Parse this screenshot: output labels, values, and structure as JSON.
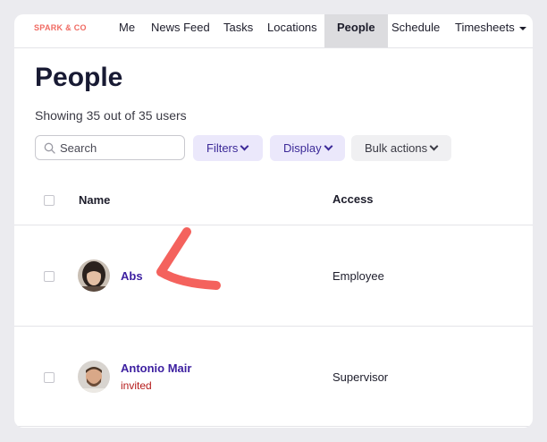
{
  "brand": {
    "logo_text": "SPARK & CO"
  },
  "nav": {
    "items": [
      {
        "label": "Me"
      },
      {
        "label": "News Feed"
      },
      {
        "label": "Tasks"
      },
      {
        "label": "Locations"
      },
      {
        "label": "People",
        "active": true
      },
      {
        "label": "Schedule"
      },
      {
        "label": "Timesheets",
        "dropdown": true
      }
    ]
  },
  "page": {
    "title": "People",
    "count_text": "Showing 35 out of 35 users"
  },
  "toolbar": {
    "search_placeholder": "Search",
    "filters_label": "Filters",
    "display_label": "Display",
    "bulk_label": "Bulk actions"
  },
  "table": {
    "headers": {
      "name": "Name",
      "access": "Access"
    },
    "rows": [
      {
        "name": "Abs",
        "access": "Employee",
        "status": ""
      },
      {
        "name": "Antonio Mair",
        "access": "Supervisor",
        "status": "invited"
      }
    ]
  },
  "colors": {
    "brand": "#f06a62",
    "accent": "#3c2a98",
    "link": "#3c1fa0",
    "invited": "#b51a1a",
    "annotation": "#f4625d"
  }
}
